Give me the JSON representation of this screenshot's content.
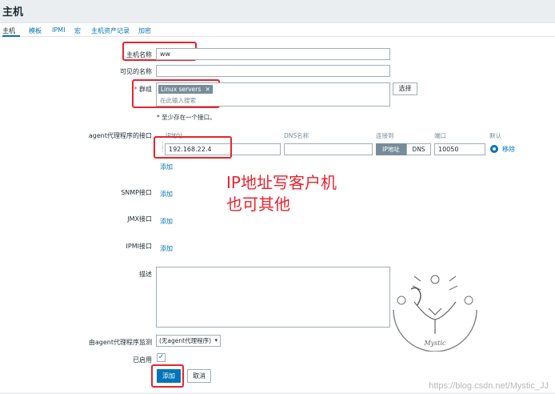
{
  "page": {
    "title": "主机"
  },
  "tabs": [
    {
      "label": "主机"
    },
    {
      "label": "模板"
    },
    {
      "label": "IPMI"
    },
    {
      "label": "宏"
    },
    {
      "label": "主机资产记录"
    },
    {
      "label": "加密"
    }
  ],
  "form": {
    "hostname": {
      "label": "主机名称",
      "value": "ww"
    },
    "visible_name": {
      "label": "可见的名称",
      "value": ""
    },
    "groups": {
      "label": "群组",
      "tag": "Linux servers",
      "placeholder": "在此输入搜索",
      "select_label": "选择",
      "hint": "* 至少存在一个接口。"
    },
    "agent_interfaces": {
      "label": "agent代理程序的接口",
      "col_ip": "IP地址",
      "col_dns": "DNS名称",
      "col_connect": "连接到",
      "col_port": "端口",
      "col_default": "默认",
      "ip_value": "192.168.22.4",
      "dns_value": "",
      "connect_ip": "IP地址",
      "connect_dns": "DNS",
      "port_value": "10050",
      "remove_label": "移除",
      "add_label": "添加"
    },
    "snmp": {
      "label": "SNMP接口",
      "add_label": "添加"
    },
    "jmx": {
      "label": "JMX接口",
      "add_label": "添加"
    },
    "ipmi": {
      "label": "IPMI接口",
      "add_label": "添加"
    },
    "description": {
      "label": "描述",
      "value": ""
    },
    "proxy": {
      "label": "由agent代理程序监测",
      "value": "(无agent代理程序)"
    },
    "enabled": {
      "label": "已启用",
      "checked": true
    }
  },
  "buttons": {
    "add": "添加",
    "cancel": "取消"
  },
  "annotation": {
    "line1": "IP地址写客户机",
    "line2": "也可其他"
  },
  "watermark": "https://blog.csdn.net/Mystic_JJ",
  "stamp_text": "Mystic",
  "colors": {
    "accent": "#0275b8",
    "annotation_red": "#e8232e"
  }
}
